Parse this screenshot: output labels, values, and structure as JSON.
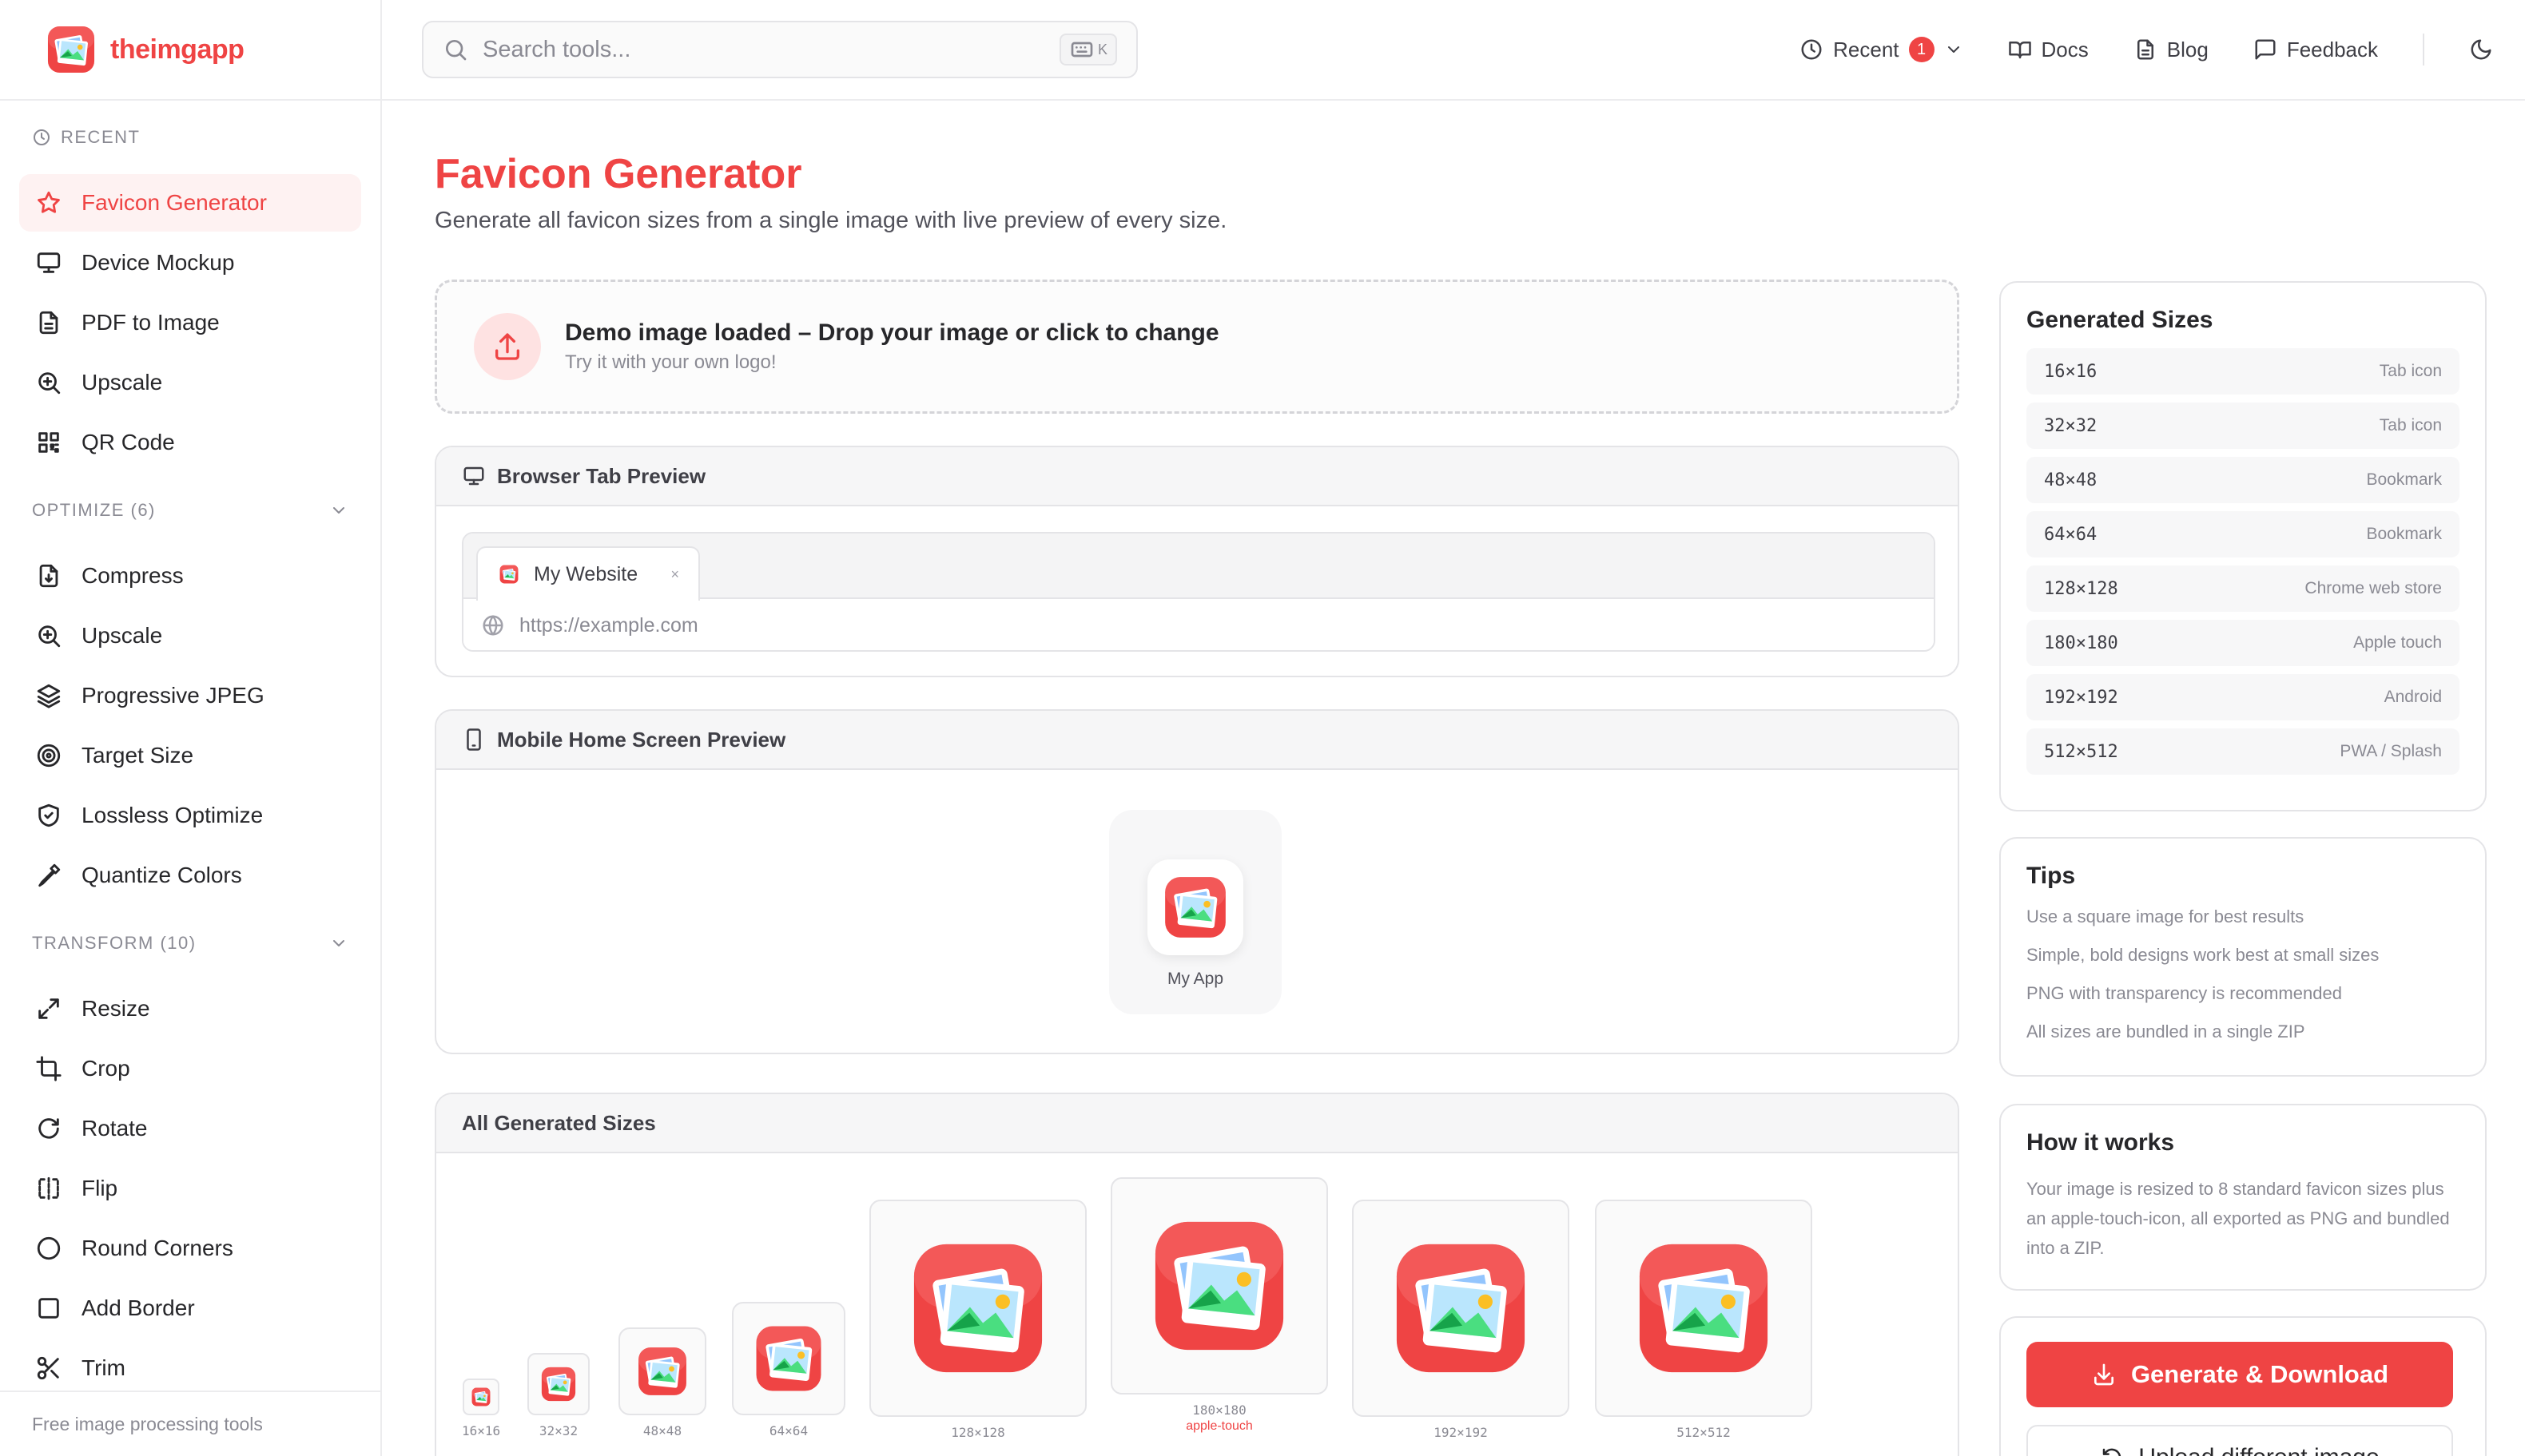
{
  "brand": {
    "name": "theimgapp"
  },
  "search": {
    "placeholder": "Search tools...",
    "shortcut": "K"
  },
  "topnav": {
    "recent_label": "Recent",
    "recent_count": "1",
    "docs_label": "Docs",
    "blog_label": "Blog",
    "feedback_label": "Feedback"
  },
  "sidebar": {
    "recent_heading": "RECENT",
    "recent_items": [
      {
        "label": "Favicon Generator",
        "icon": "star-icon",
        "active": true
      },
      {
        "label": "Device Mockup",
        "icon": "monitor-icon"
      },
      {
        "label": "PDF to Image",
        "icon": "file-icon"
      },
      {
        "label": "Upscale",
        "icon": "zoom-in-icon"
      },
      {
        "label": "QR Code",
        "icon": "qr-code-icon"
      }
    ],
    "optimize_heading": "OPTIMIZE (6)",
    "optimize_items": [
      {
        "label": "Compress",
        "icon": "file-compress-icon"
      },
      {
        "label": "Upscale",
        "icon": "zoom-in-icon"
      },
      {
        "label": "Progressive JPEG",
        "icon": "layers-icon"
      },
      {
        "label": "Target Size",
        "icon": "target-icon"
      },
      {
        "label": "Lossless Optimize",
        "icon": "shield-check-icon"
      },
      {
        "label": "Quantize Colors",
        "icon": "pipette-icon"
      }
    ],
    "transform_heading": "TRANSFORM (10)",
    "transform_items": [
      {
        "label": "Resize",
        "icon": "resize-icon"
      },
      {
        "label": "Crop",
        "icon": "crop-icon"
      },
      {
        "label": "Rotate",
        "icon": "rotate-icon"
      },
      {
        "label": "Flip",
        "icon": "flip-icon"
      },
      {
        "label": "Round Corners",
        "icon": "circle-icon"
      },
      {
        "label": "Add Border",
        "icon": "square-icon"
      },
      {
        "label": "Trim",
        "icon": "scissors-icon"
      }
    ],
    "footer": "Free image processing tools"
  },
  "page": {
    "title": "Favicon Generator",
    "subtitle": "Generate all favicon sizes from a single image with live preview of every size."
  },
  "upload": {
    "title": "Demo image loaded – Drop your image or click to change",
    "subtitle": "Try it with your own logo!"
  },
  "browser_preview": {
    "heading": "Browser Tab Preview",
    "tab_title": "My Website",
    "tab_close": "×",
    "url": "https://example.com"
  },
  "mobile_preview": {
    "heading": "Mobile Home Screen Preview",
    "app_name": "My App"
  },
  "all_sizes": {
    "heading": "All Generated Sizes",
    "items": [
      {
        "label": "16×16"
      },
      {
        "label": "32×32"
      },
      {
        "label": "48×48"
      },
      {
        "label": "64×64"
      },
      {
        "label": "128×128"
      },
      {
        "label": "180×180",
        "sub": "apple-touch"
      },
      {
        "label": "192×192"
      },
      {
        "label": "512×512"
      }
    ]
  },
  "generated_sizes": {
    "heading": "Generated Sizes",
    "items": [
      {
        "dim": "16×16",
        "use": "Tab icon"
      },
      {
        "dim": "32×32",
        "use": "Tab icon"
      },
      {
        "dim": "48×48",
        "use": "Bookmark"
      },
      {
        "dim": "64×64",
        "use": "Bookmark"
      },
      {
        "dim": "128×128",
        "use": "Chrome web store"
      },
      {
        "dim": "180×180",
        "use": "Apple touch"
      },
      {
        "dim": "192×192",
        "use": "Android"
      },
      {
        "dim": "512×512",
        "use": "PWA / Splash"
      }
    ]
  },
  "tips": {
    "heading": "Tips",
    "items": [
      "Use a square image for best results",
      "Simple, bold designs work best at small sizes",
      "PNG with transparency is recommended",
      "All sizes are bundled in a single ZIP"
    ]
  },
  "how_it_works": {
    "heading": "How it works",
    "body": "Your image is resized to 8 standard favicon sizes plus an apple-touch-icon, all exported as PNG and bundled into a ZIP."
  },
  "actions": {
    "generate_label": "Generate & Download",
    "upload_label": "Upload different image"
  },
  "colors": {
    "accent": "#ef4444",
    "accent_soft": "#fef2f2"
  }
}
